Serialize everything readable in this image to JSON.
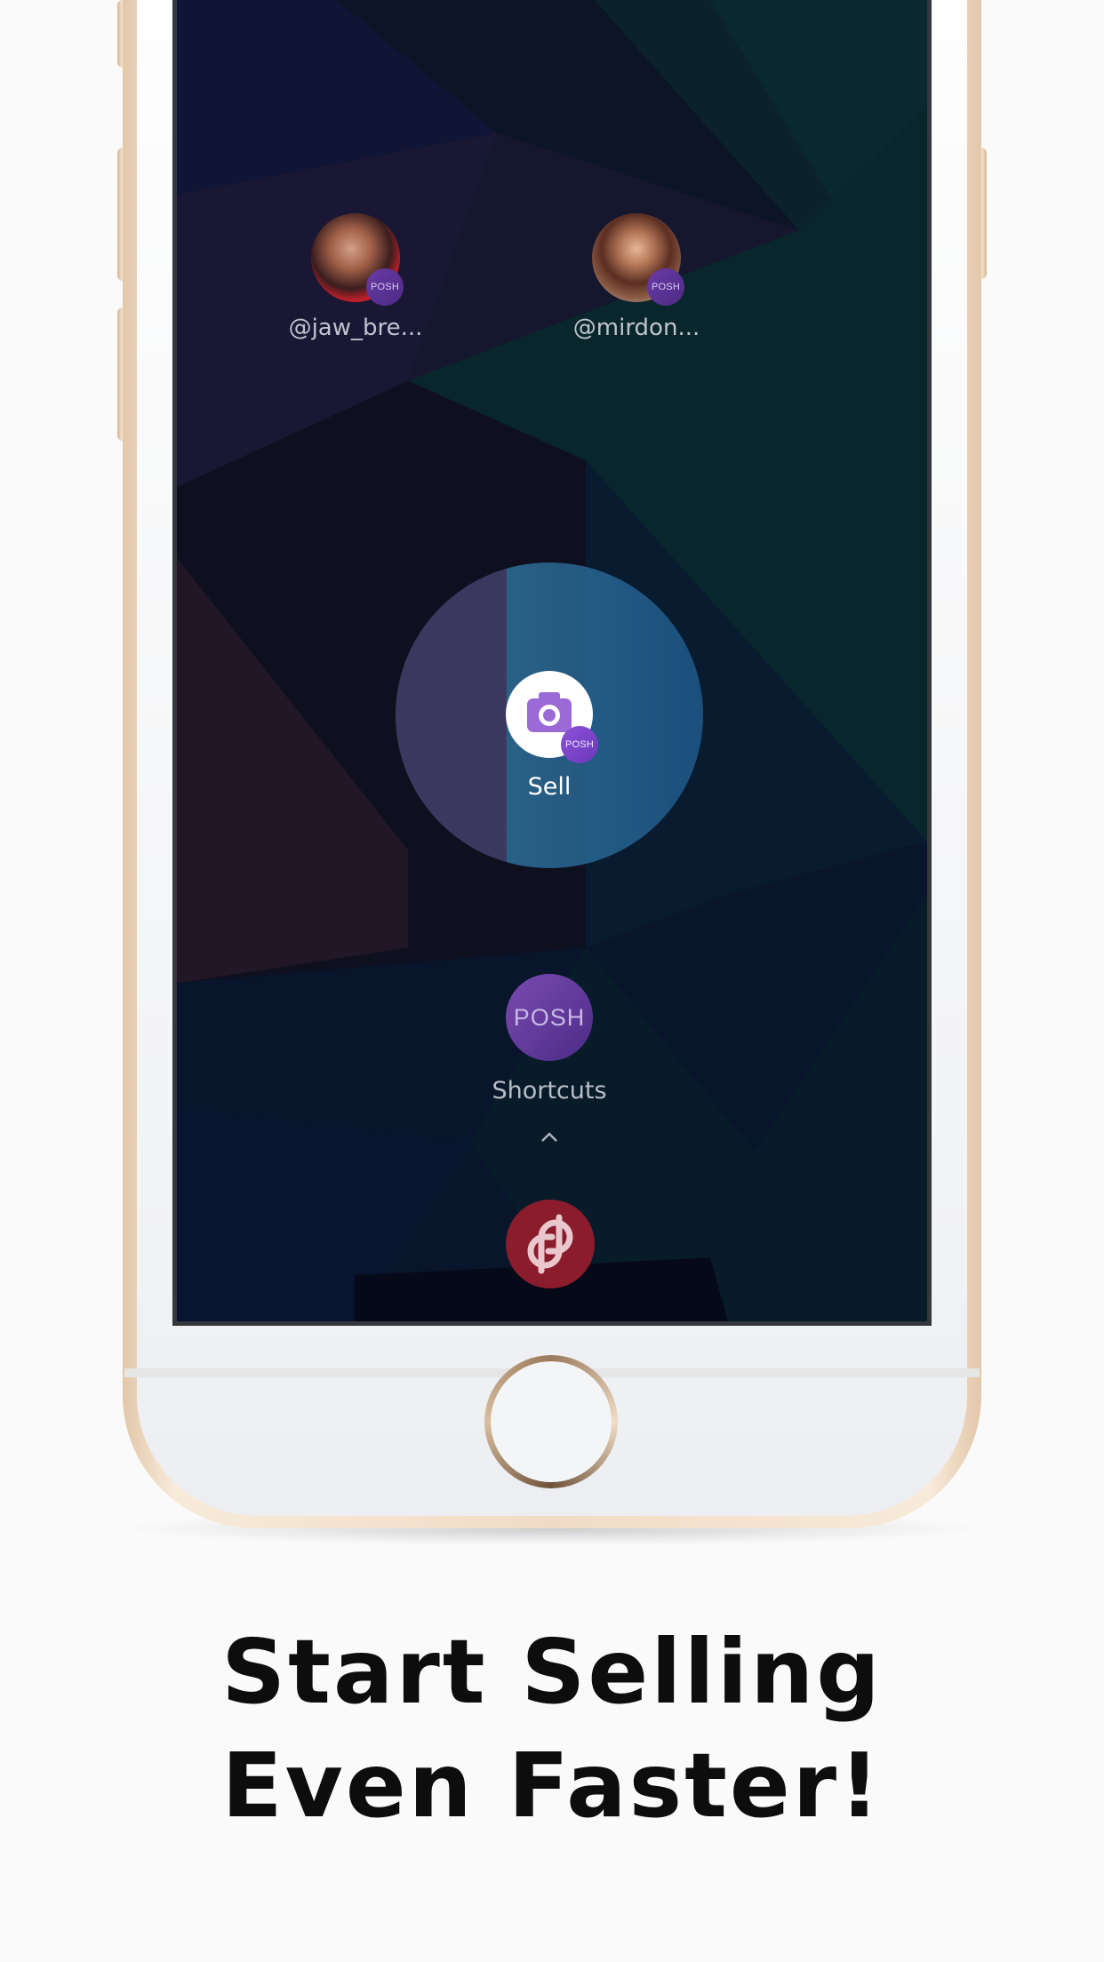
{
  "screen": {
    "contacts": [
      {
        "handle": "@jaw_bre...",
        "badge": "POSH"
      },
      {
        "handle": "@mirdon...",
        "badge": "POSH"
      }
    ],
    "sell": {
      "label": "Sell",
      "badge": "POSH",
      "icon": "camera-icon"
    },
    "posh_button": {
      "text": "POSH"
    },
    "shortcuts_label": "Shortcuts",
    "app_icon": "poshmark-logo-icon"
  },
  "headline": {
    "line1": "Start Selling",
    "line2": "Even Faster!"
  },
  "colors": {
    "posh_purple": "#5b3596",
    "app_red": "#8a1c2c",
    "frame_gold": "#e3c7a9"
  }
}
